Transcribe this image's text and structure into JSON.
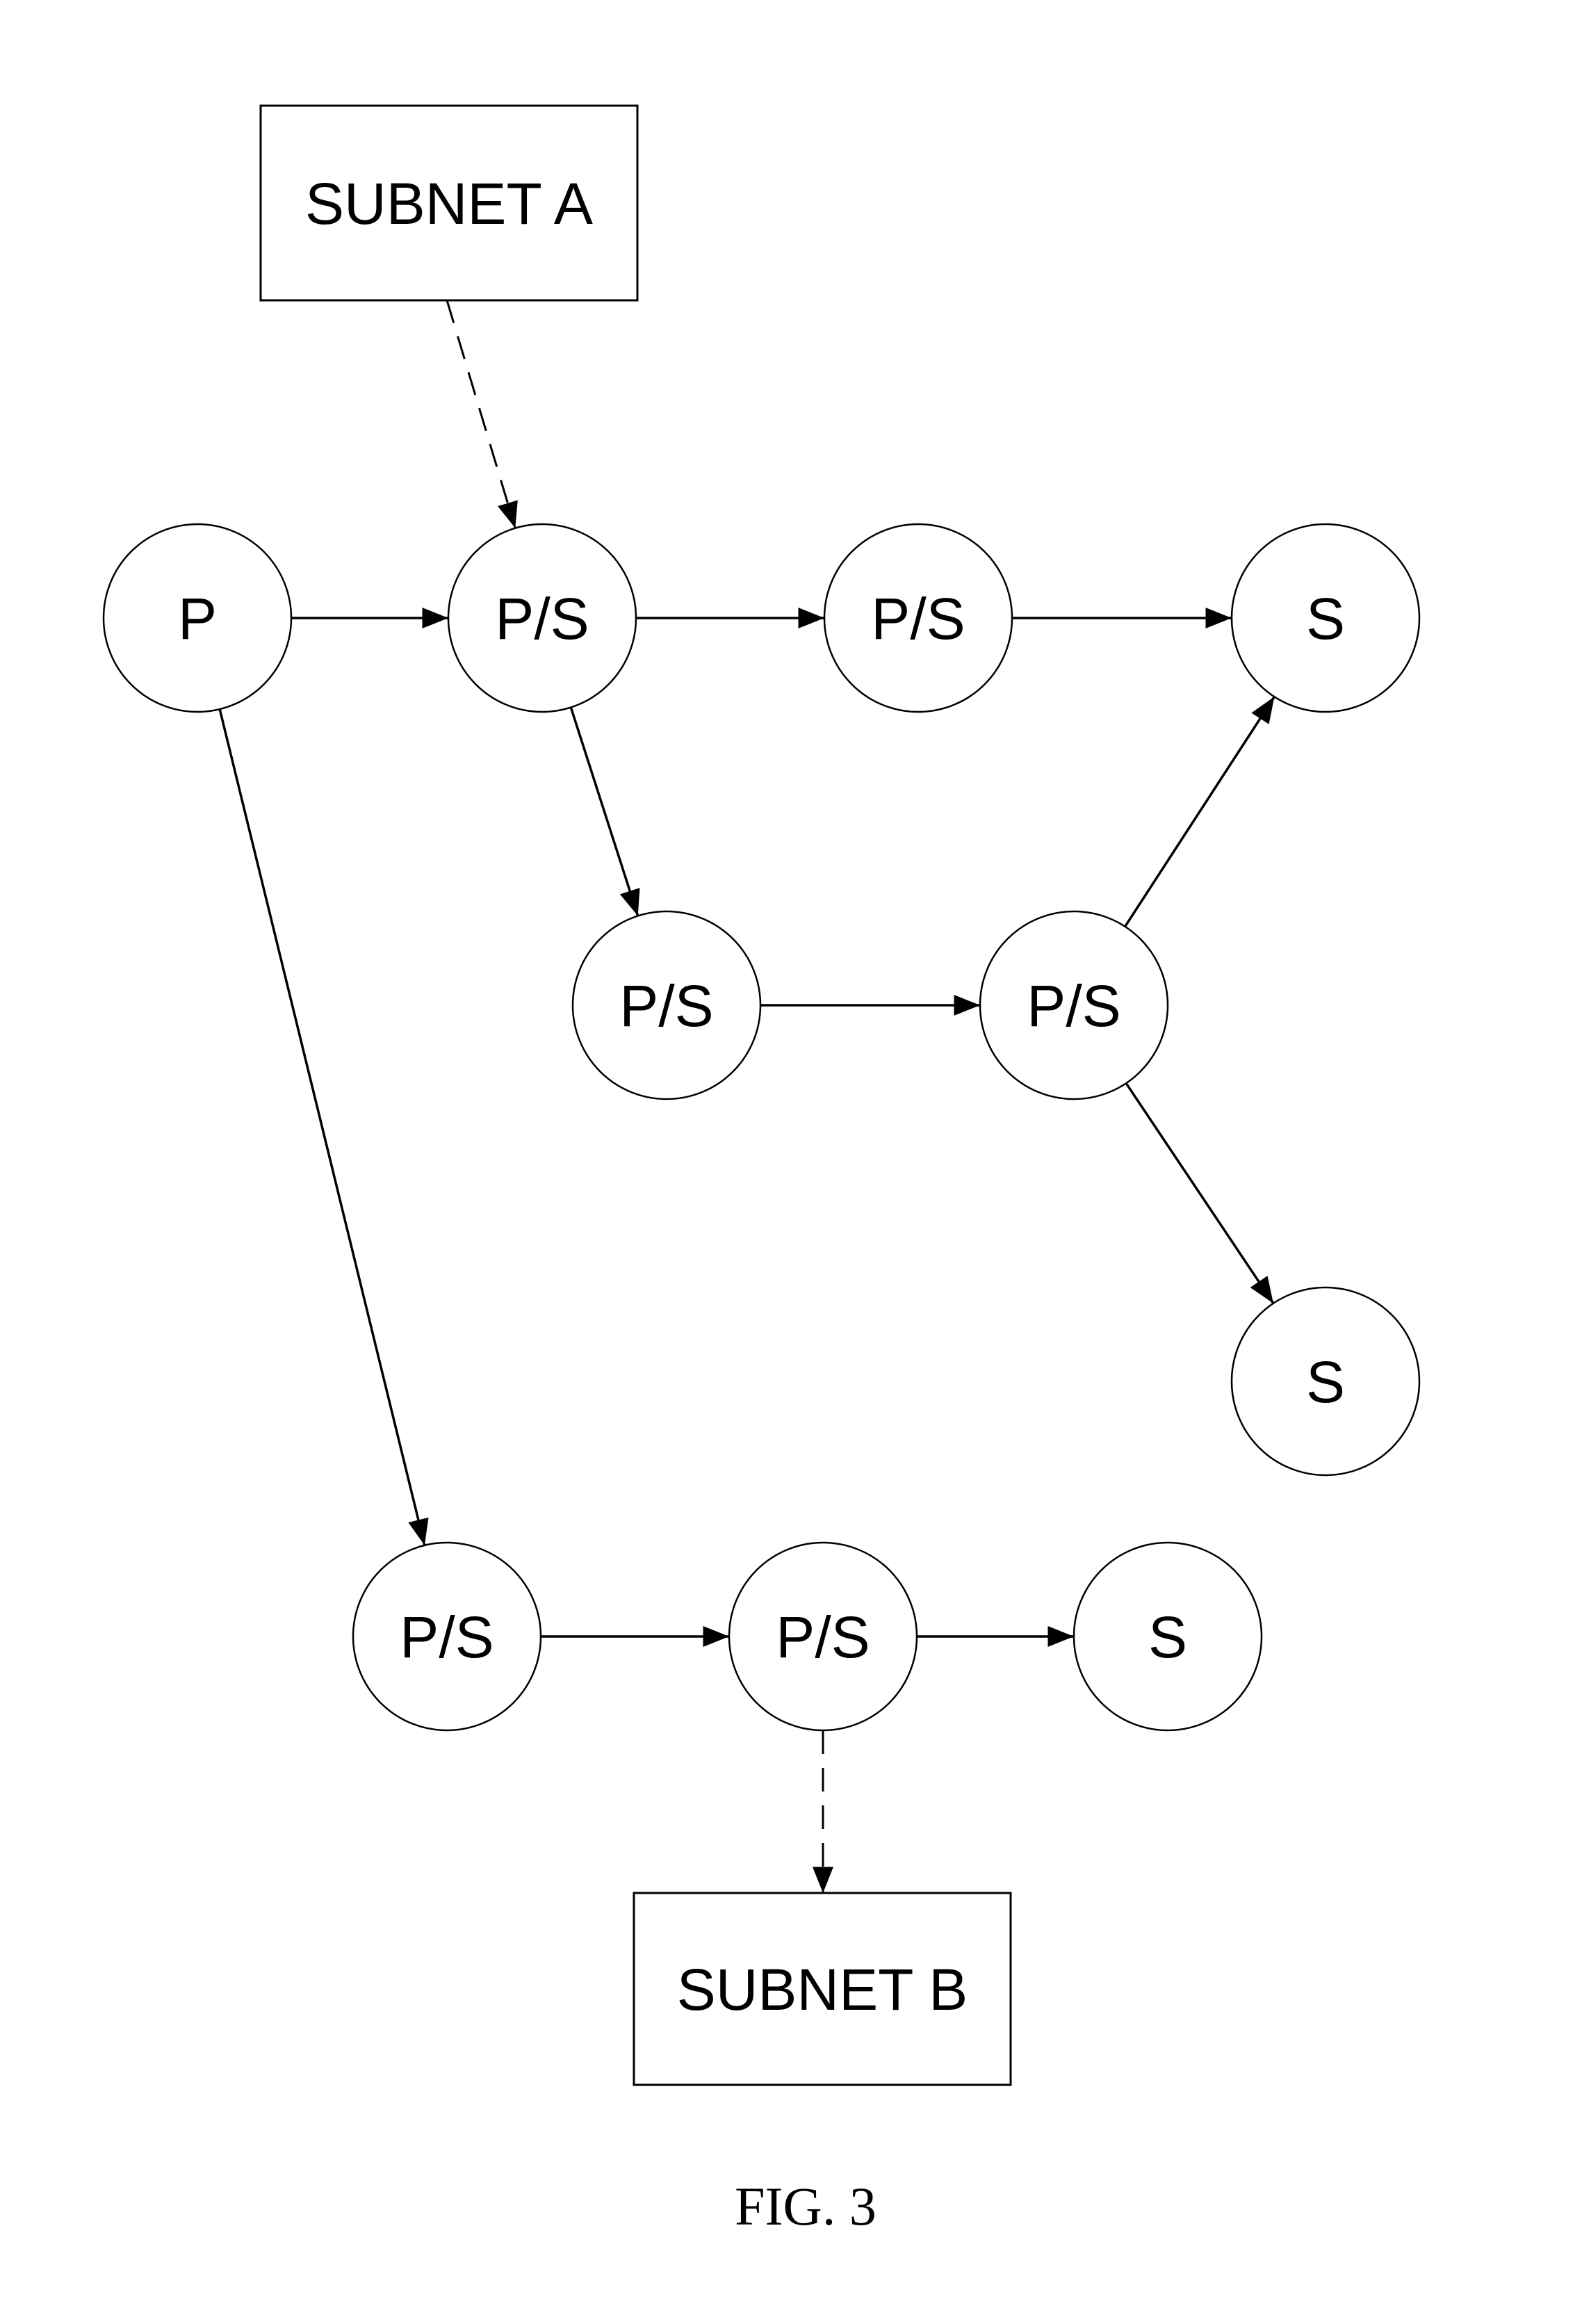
{
  "figure": {
    "caption": "FIG. 3"
  },
  "boxes": [
    {
      "id": "subnetA",
      "label": "SUBNET A"
    },
    {
      "id": "subnetB",
      "label": "SUBNET B"
    }
  ],
  "nodes": [
    {
      "id": "p",
      "label": "P"
    },
    {
      "id": "ps1",
      "label": "P/S"
    },
    {
      "id": "ps2",
      "label": "P/S"
    },
    {
      "id": "s1",
      "label": "S"
    },
    {
      "id": "ps3",
      "label": "P/S"
    },
    {
      "id": "ps4",
      "label": "P/S"
    },
    {
      "id": "s2",
      "label": "S"
    },
    {
      "id": "ps5",
      "label": "P/S"
    },
    {
      "id": "ps6",
      "label": "P/S"
    },
    {
      "id": "s3",
      "label": "S"
    }
  ],
  "edges": [
    {
      "from": "subnetA",
      "to": "ps1",
      "style": "dashed"
    },
    {
      "from": "p",
      "to": "ps1",
      "style": "solid"
    },
    {
      "from": "ps1",
      "to": "ps2",
      "style": "solid"
    },
    {
      "from": "ps2",
      "to": "s1",
      "style": "solid"
    },
    {
      "from": "ps1",
      "to": "ps3",
      "style": "solid"
    },
    {
      "from": "ps3",
      "to": "ps4",
      "style": "solid"
    },
    {
      "from": "ps4",
      "to": "s1",
      "style": "solid"
    },
    {
      "from": "ps4",
      "to": "s2",
      "style": "solid"
    },
    {
      "from": "p",
      "to": "ps5",
      "style": "solid"
    },
    {
      "from": "ps5",
      "to": "ps6",
      "style": "solid"
    },
    {
      "from": "ps6",
      "to": "s3",
      "style": "solid"
    },
    {
      "from": "ps6",
      "to": "subnetB",
      "style": "dashed"
    }
  ]
}
